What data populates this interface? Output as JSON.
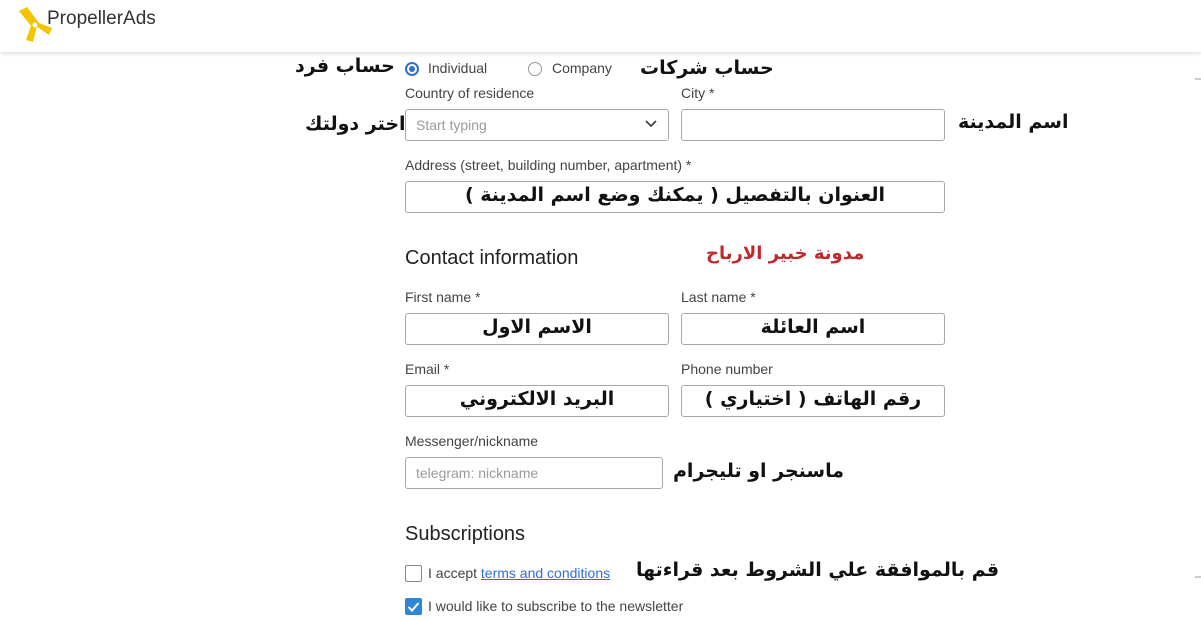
{
  "brand": {
    "name": "PropellerAds"
  },
  "account_type": {
    "individual_label": "Individual",
    "company_label": "Company",
    "selected": "individual",
    "annot_individual": "حساب فرد",
    "annot_company": "حساب شركات"
  },
  "country": {
    "label": "Country of residence",
    "placeholder": "Start typing",
    "annot": "اختر دولتك"
  },
  "city": {
    "label": "City *",
    "annot": "اسم المدينة"
  },
  "address": {
    "label": "Address (street, building number, apartment) *",
    "annot": "العنوان بالتفصيل ( يمكنك وضع اسم المدينة )"
  },
  "contact": {
    "title": "Contact information",
    "watermark": "مدونة خبير الارباح",
    "first_name": {
      "label": "First name *",
      "annot": "الاسم الاول"
    },
    "last_name": {
      "label": "Last name *",
      "annot": "اسم العائلة"
    },
    "email": {
      "label": "Email *",
      "annot": "البريد الالكتروني"
    },
    "phone": {
      "label": "Phone number",
      "annot": "رقم الهاتف ( اختياري )"
    },
    "messenger": {
      "label": "Messenger/nickname",
      "placeholder": "telegram: nickname",
      "annot": "ماسنجر او تليجرام"
    }
  },
  "subscriptions": {
    "title": "Subscriptions",
    "terms_prefix": "I accept",
    "terms_link": "terms and conditions",
    "terms_checked": false,
    "terms_annot": "قم بالموافقة علي الشروط بعد قراءتها",
    "newsletter_label": "I would like to subscribe to the newsletter",
    "newsletter_checked": true
  },
  "colors": {
    "accent": "#2f6fd6",
    "watermark": "#c0282d",
    "logo": "#f2c500"
  }
}
